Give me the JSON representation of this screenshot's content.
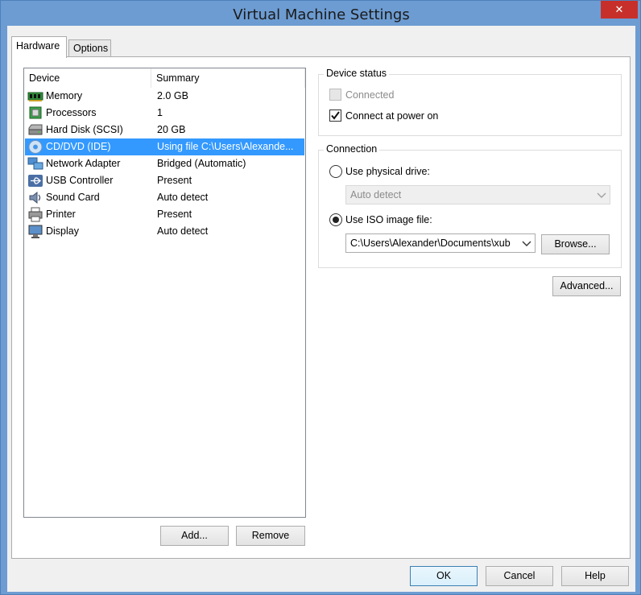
{
  "window": {
    "title": "Virtual Machine Settings",
    "close_glyph": "✕"
  },
  "tabs": [
    {
      "label": "Hardware",
      "active": true
    },
    {
      "label": "Options",
      "active": false
    }
  ],
  "device_list": {
    "columns": [
      "Device",
      "Summary"
    ],
    "rows": [
      {
        "device": "Memory",
        "summary": "2.0 GB",
        "icon": "memory-icon"
      },
      {
        "device": "Processors",
        "summary": "1",
        "icon": "processor-icon"
      },
      {
        "device": "Hard Disk (SCSI)",
        "summary": "20 GB",
        "icon": "hard-disk-icon"
      },
      {
        "device": "CD/DVD (IDE)",
        "summary": "Using file C:\\Users\\Alexande...",
        "icon": "cd-dvd-icon",
        "selected": true
      },
      {
        "device": "Network Adapter",
        "summary": "Bridged (Automatic)",
        "icon": "network-adapter-icon"
      },
      {
        "device": "USB Controller",
        "summary": "Present",
        "icon": "usb-icon"
      },
      {
        "device": "Sound Card",
        "summary": "Auto detect",
        "icon": "speaker-icon"
      },
      {
        "device": "Printer",
        "summary": "Present",
        "icon": "printer-icon"
      },
      {
        "device": "Display",
        "summary": "Auto detect",
        "icon": "monitor-icon"
      }
    ]
  },
  "buttons": {
    "add": "Add...",
    "remove": "Remove",
    "browse": "Browse...",
    "advanced": "Advanced...",
    "ok": "OK",
    "cancel": "Cancel",
    "help": "Help"
  },
  "device_status": {
    "title": "Device status",
    "connected_label": "Connected",
    "connected_checked": false,
    "connected_enabled": false,
    "power_on_label": "Connect at power on",
    "power_on_checked": true
  },
  "connection": {
    "title": "Connection",
    "physical_label": "Use physical drive:",
    "physical_selected": false,
    "physical_value": "Auto detect",
    "iso_label": "Use ISO image file:",
    "iso_selected": true,
    "iso_value": "C:\\Users\\Alexander\\Documents\\xub"
  },
  "colors": {
    "title_bar": "#6d9cd2",
    "close_button": "#c7302a",
    "selection": "#3399ff"
  }
}
